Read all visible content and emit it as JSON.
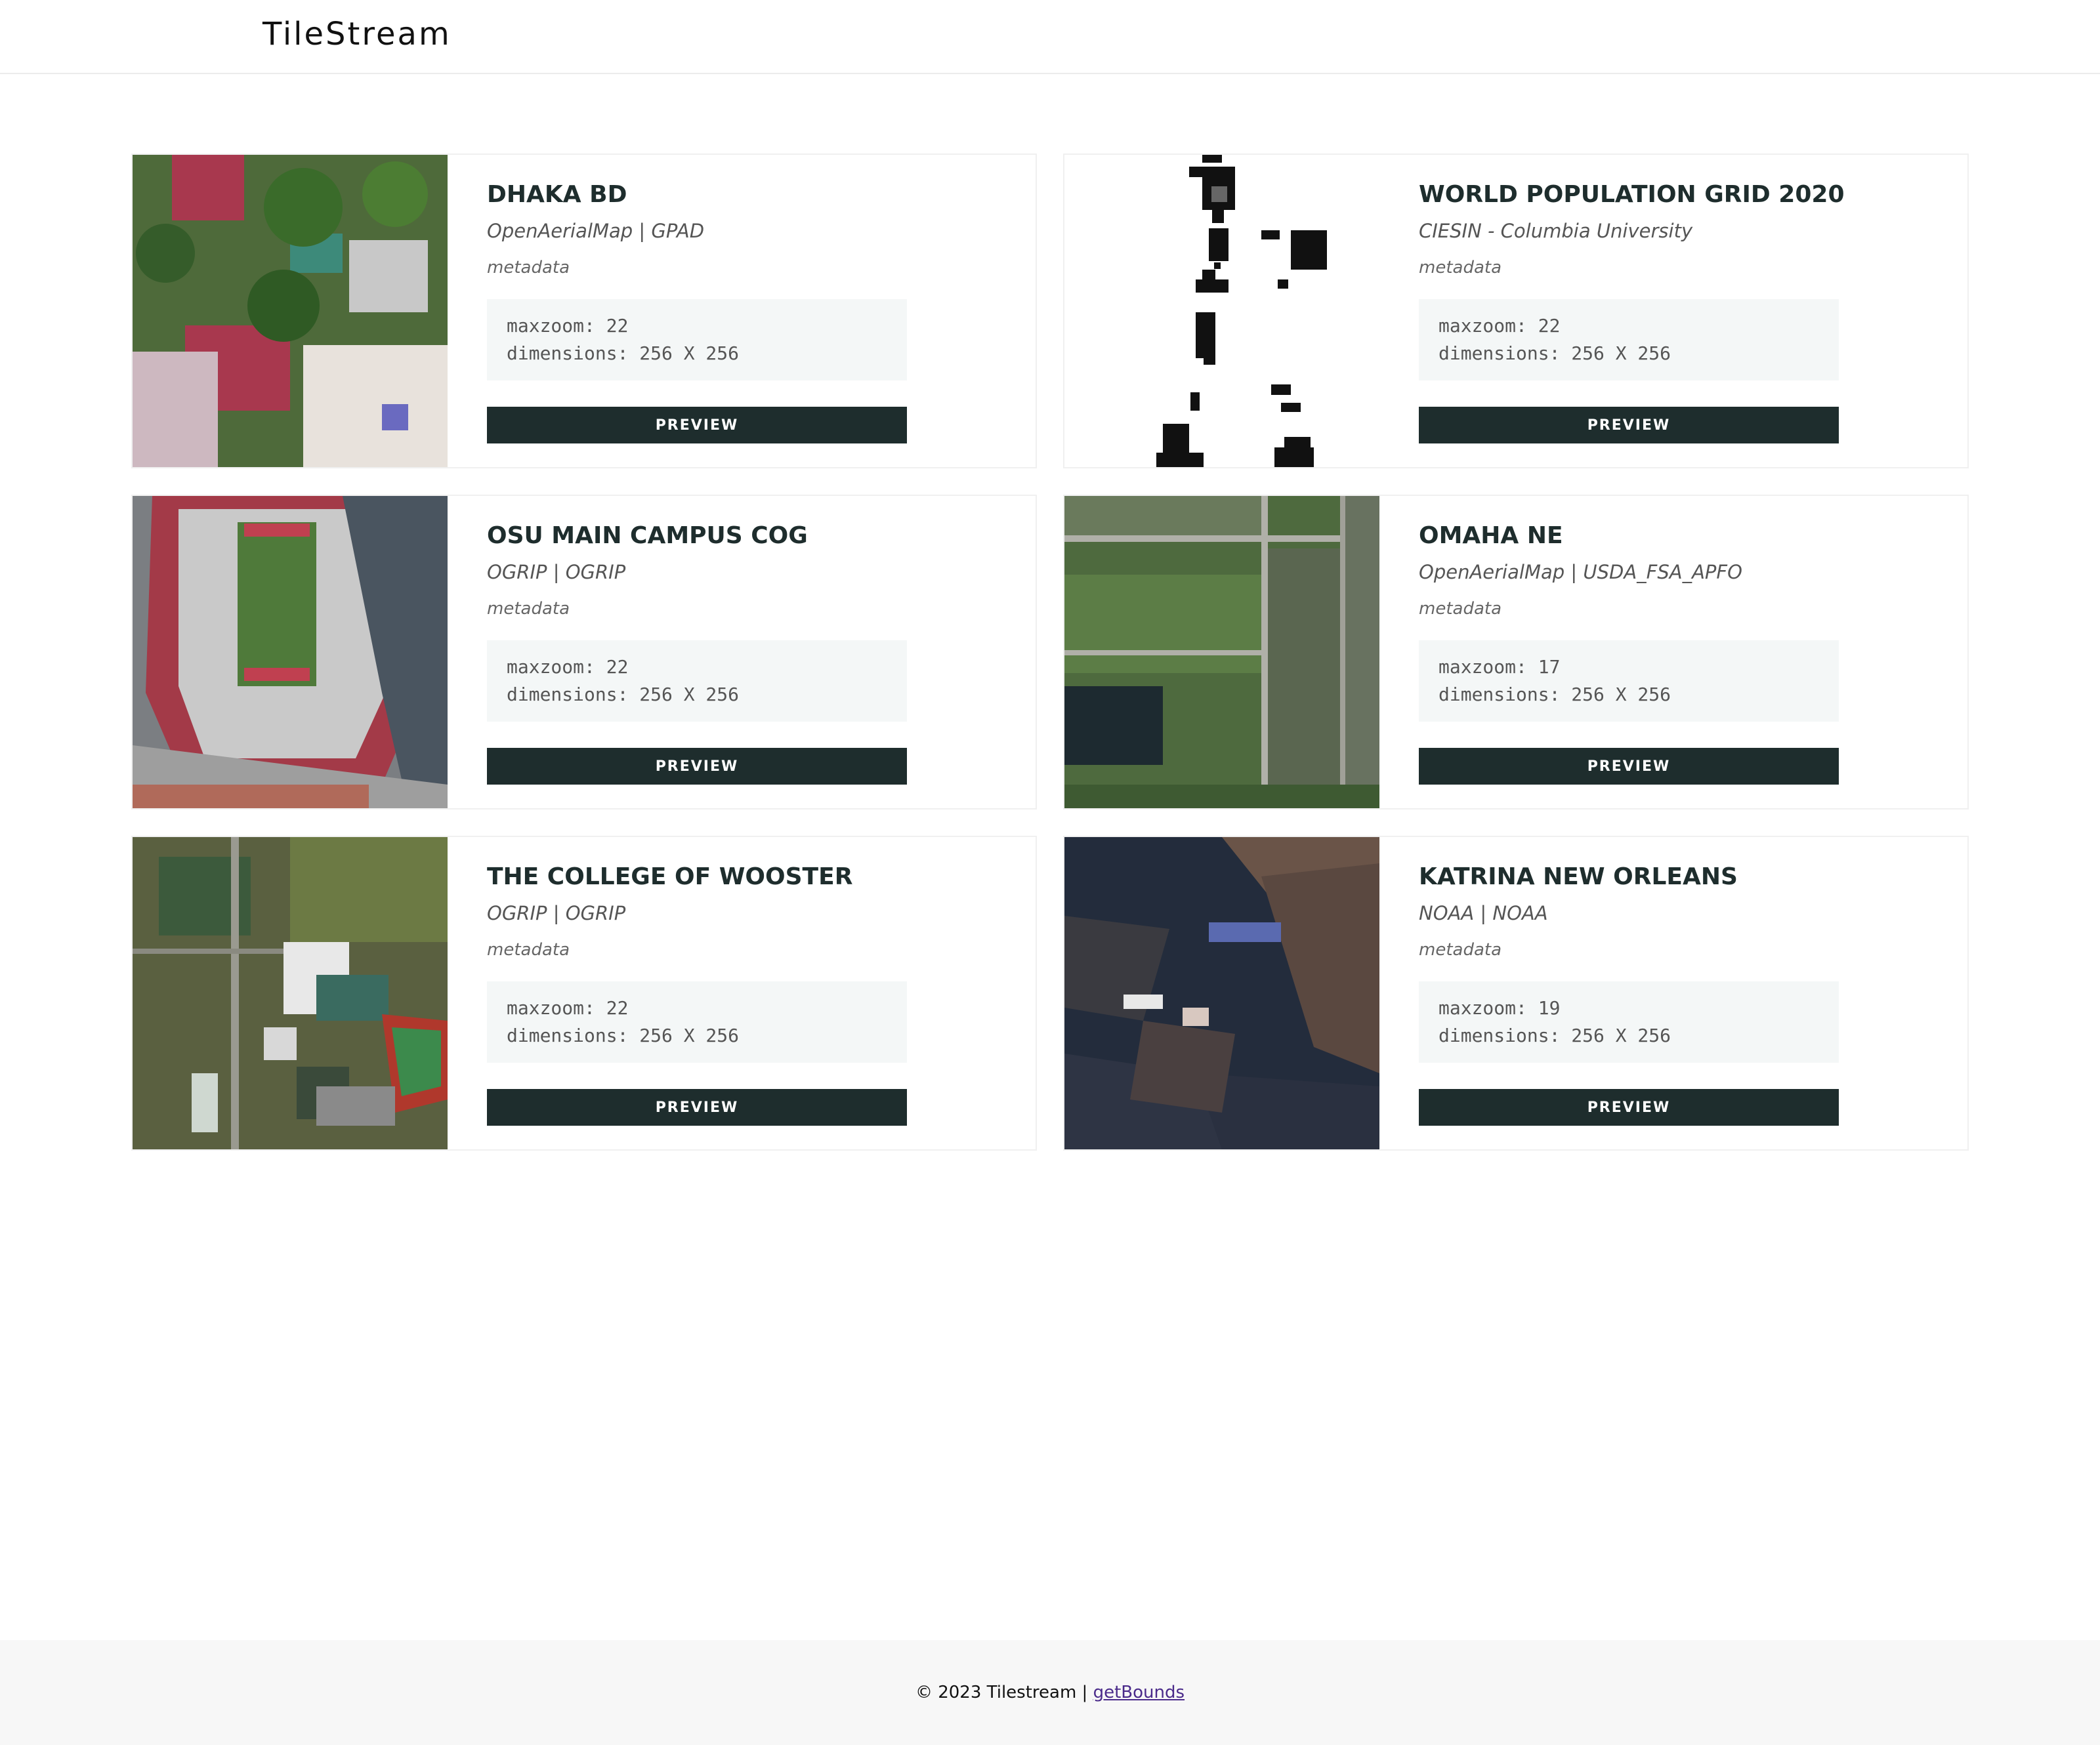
{
  "app": {
    "brand": "TileStream"
  },
  "cards": [
    {
      "title": "DHAKA BD",
      "source": "OpenAerialMap | GPAD",
      "meta_label": "metadata",
      "maxzoom": "maxzoom: 22",
      "dimensions": "dimensions: 256 X 256",
      "button": "PREVIEW"
    },
    {
      "title": "WORLD POPULATION GRID 2020",
      "source": "CIESIN - Columbia University",
      "meta_label": "metadata",
      "maxzoom": "maxzoom: 22",
      "dimensions": "dimensions: 256 X 256",
      "button": "PREVIEW"
    },
    {
      "title": "OSU MAIN CAMPUS COG",
      "source": "OGRIP | OGRIP",
      "meta_label": "metadata",
      "maxzoom": "maxzoom: 22",
      "dimensions": "dimensions: 256 X 256",
      "button": "PREVIEW"
    },
    {
      "title": "OMAHA NE",
      "source": "OpenAerialMap | USDA_FSA_APFO",
      "meta_label": "metadata",
      "maxzoom": "maxzoom: 17",
      "dimensions": "dimensions: 256 X 256",
      "button": "PREVIEW"
    },
    {
      "title": "THE COLLEGE OF WOOSTER",
      "source": "OGRIP | OGRIP",
      "meta_label": "metadata",
      "maxzoom": "maxzoom: 22",
      "dimensions": "dimensions: 256 X 256",
      "button": "PREVIEW"
    },
    {
      "title": "KATRINA NEW ORLEANS",
      "source": "NOAA | NOAA",
      "meta_label": "metadata",
      "maxzoom": "maxzoom: 19",
      "dimensions": "dimensions: 256 X 256",
      "button": "PREVIEW"
    }
  ],
  "footer": {
    "copyright": "© 2023 Tilestream | ",
    "link": "getBounds"
  },
  "colors": {
    "primary": "#1e2d2d",
    "meta_bg": "#f4f7f7",
    "footer_bg": "#f7f7f7",
    "link": "#4a2a8a"
  }
}
